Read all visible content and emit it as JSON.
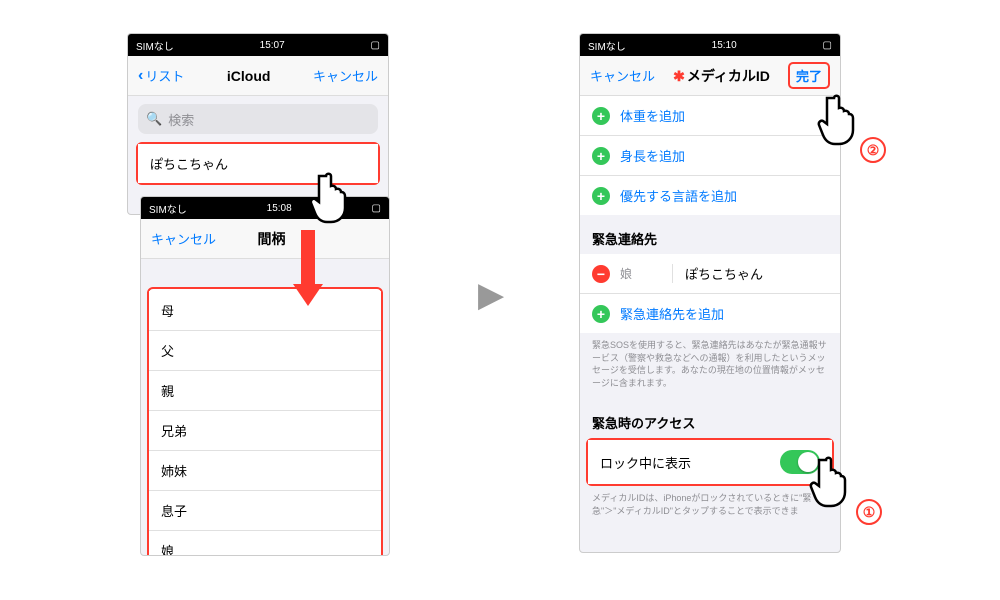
{
  "phoneA": {
    "status": {
      "carrier": "SIMなし",
      "wifi": "⋮",
      "time": "15:07",
      "batt": "▮"
    },
    "nav": {
      "back": "リスト",
      "title": "iCloud",
      "cancel": "キャンセル"
    },
    "search_placeholder": "検索",
    "contact_name": "ぽちこちゃん"
  },
  "phoneB": {
    "status": {
      "carrier": "SIMなし",
      "wifi": "⋮",
      "time": "15:08",
      "batt": "▮"
    },
    "nav": {
      "cancel": "キャンセル",
      "title": "間柄"
    },
    "options": [
      "母",
      "父",
      "親",
      "兄弟",
      "姉妹",
      "息子",
      "娘"
    ]
  },
  "phoneC": {
    "status": {
      "carrier": "SIMなし",
      "wifi": "⋮",
      "time": "15:10",
      "batt": "▮"
    },
    "nav": {
      "cancel": "キャンセル",
      "title": "メディカルID",
      "done": "完了"
    },
    "adds": [
      {
        "label": "体重を追加"
      },
      {
        "label": "身長を追加"
      },
      {
        "label": "優先する言語を追加"
      }
    ],
    "contacts_header": "緊急連絡先",
    "contact": {
      "relation": "娘",
      "name": "ぽちこちゃん"
    },
    "add_contact": "緊急連絡先を追加",
    "contacts_footer": "緊急SOSを使用すると、緊急連絡先はあなたが緊急通報サービス（警察や救急などへの通報）を利用したというメッセージを受信します。あなたの現在地の位置情報がメッセージに含まれます。",
    "access_header": "緊急時のアクセス",
    "lock_label": "ロック中に表示",
    "access_footer": "メディカルIDは、iPhoneがロックされているときに\"緊急\"＞\"メディカルID\"とタップすることで表示できま"
  },
  "callouts": {
    "one": "①",
    "two": "②"
  }
}
